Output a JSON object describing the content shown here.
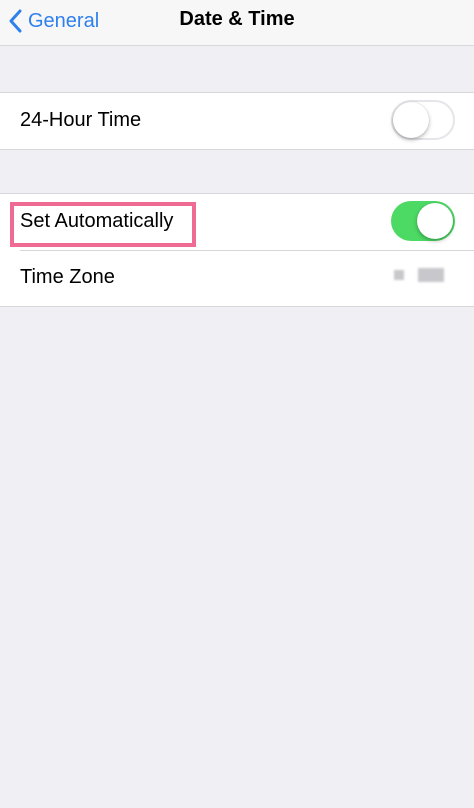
{
  "navbar": {
    "back_label": "General",
    "title": "Date & Time"
  },
  "settings": {
    "hour24": {
      "label": "24-Hour Time",
      "enabled": false
    },
    "set_automatically": {
      "label": "Set Automatically",
      "enabled": true
    },
    "time_zone": {
      "label": "Time Zone"
    }
  },
  "colors": {
    "accent": "#2f80ed",
    "toggle_on": "#4cd964",
    "highlight": "#ef6b94",
    "background": "#efeff4"
  }
}
